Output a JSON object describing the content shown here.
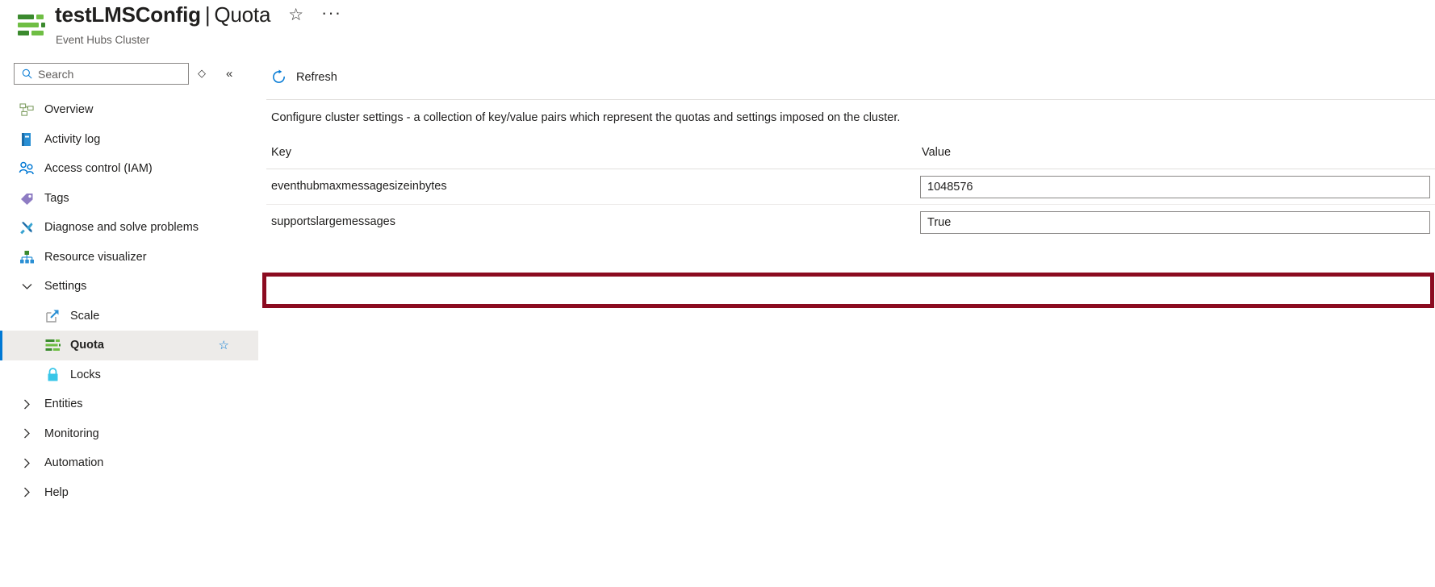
{
  "header": {
    "resource_icon": "quota-cluster-icon",
    "title": "testLMSConfig",
    "separator": "|",
    "page_name": "Quota",
    "subtitle": "Event Hubs Cluster",
    "favorite_icon": "star-outline-icon",
    "more_icon": "ellipsis-icon"
  },
  "sidebar": {
    "search": {
      "placeholder": "Search",
      "value": "",
      "icon": "search-icon"
    },
    "tools": [
      {
        "name": "expand-collapse-all-icon",
        "glyph": "◇"
      },
      {
        "name": "collapse-sidebar-icon",
        "glyph": "«"
      }
    ],
    "items": [
      {
        "label": "Overview",
        "icon": "overview-icon",
        "type": "item",
        "selected": false
      },
      {
        "label": "Activity log",
        "icon": "activity-log-icon",
        "type": "item",
        "selected": false
      },
      {
        "label": "Access control (IAM)",
        "icon": "access-control-icon",
        "type": "item",
        "selected": false
      },
      {
        "label": "Tags",
        "icon": "tags-icon",
        "type": "item",
        "selected": false
      },
      {
        "label": "Diagnose and solve problems",
        "icon": "diagnose-icon",
        "type": "item",
        "selected": false
      },
      {
        "label": "Resource visualizer",
        "icon": "resource-visualizer-icon",
        "type": "item",
        "selected": false
      },
      {
        "label": "Settings",
        "icon": "chevron-down-icon",
        "type": "group-expanded",
        "selected": false
      },
      {
        "label": "Scale",
        "icon": "scale-icon",
        "type": "child",
        "selected": false
      },
      {
        "label": "Quota",
        "icon": "quota-icon",
        "type": "child",
        "selected": true,
        "favorite_icon": "star-outline-icon"
      },
      {
        "label": "Locks",
        "icon": "lock-icon",
        "type": "child",
        "selected": false
      },
      {
        "label": "Entities",
        "icon": "chevron-right-icon",
        "type": "group",
        "selected": false
      },
      {
        "label": "Monitoring",
        "icon": "chevron-right-icon",
        "type": "group",
        "selected": false
      },
      {
        "label": "Automation",
        "icon": "chevron-right-icon",
        "type": "group",
        "selected": false
      },
      {
        "label": "Help",
        "icon": "chevron-right-icon",
        "type": "group",
        "selected": false
      }
    ]
  },
  "main": {
    "commands": [
      {
        "label": "Refresh",
        "icon": "refresh-icon"
      }
    ],
    "description": "Configure cluster settings - a collection of key/value pairs which represent the quotas and settings imposed on the cluster.",
    "table": {
      "columns": [
        "Key",
        "Value"
      ],
      "rows": [
        {
          "key": "eventhubmaxmessagesizeinbytes",
          "value": "1048576",
          "highlighted": false
        },
        {
          "key": "supportslargemessages",
          "value": "True",
          "highlighted": true
        }
      ]
    }
  },
  "colors": {
    "accent": "#0078d4",
    "highlight_border": "#8b0b20",
    "selected_row_bg": "#edebe9",
    "brand_green": "#6fbe44"
  }
}
